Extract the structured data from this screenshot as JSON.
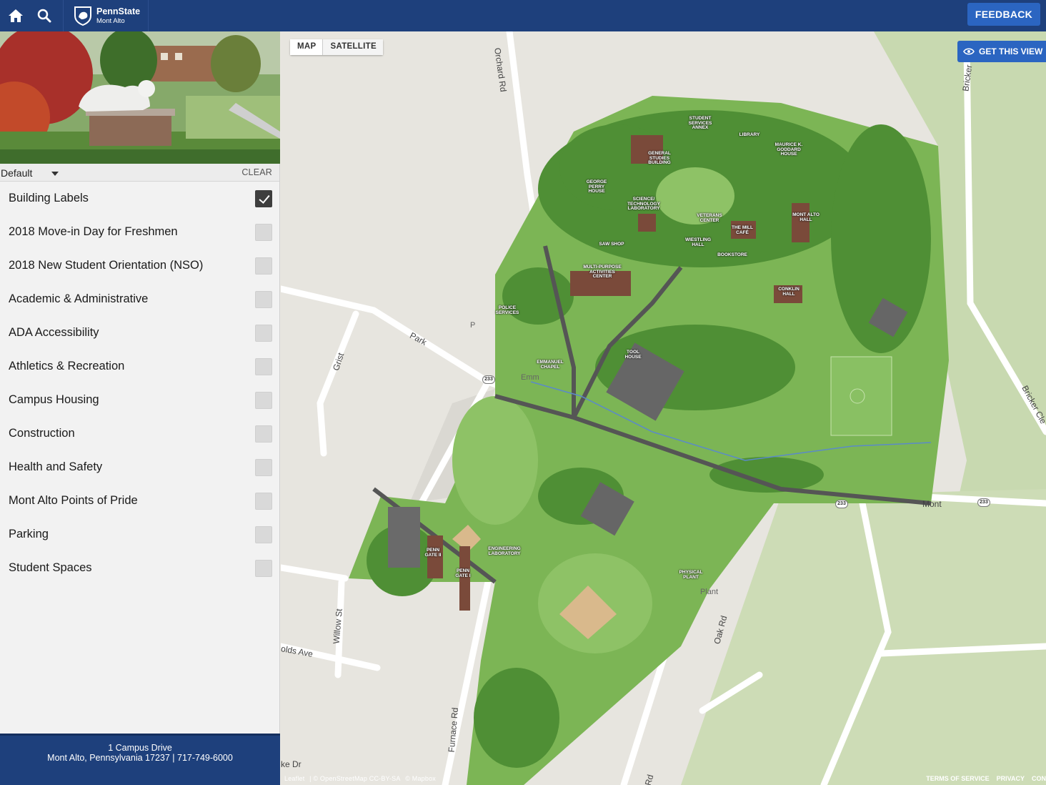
{
  "header": {
    "brand_name": "PennState",
    "brand_campus": "Mont Alto",
    "feedback_label": "FEEDBACK",
    "home_icon": "home-icon",
    "search_icon": "search-icon"
  },
  "sidebar": {
    "layer_selected": "Default",
    "clear_label": "CLEAR",
    "categories": [
      {
        "label": "Building Labels",
        "checked": true
      },
      {
        "label": "2018 Move-in Day for Freshmen",
        "checked": false
      },
      {
        "label": "2018 New Student Orientation (NSO)",
        "checked": false
      },
      {
        "label": "Academic & Administrative",
        "checked": false
      },
      {
        "label": "ADA Accessibility",
        "checked": false
      },
      {
        "label": "Athletics & Recreation",
        "checked": false
      },
      {
        "label": "Campus Housing",
        "checked": false
      },
      {
        "label": "Construction",
        "checked": false
      },
      {
        "label": "Health and Safety",
        "checked": false
      },
      {
        "label": "Mont Alto Points of Pride",
        "checked": false
      },
      {
        "label": "Parking",
        "checked": false
      },
      {
        "label": "Student Spaces",
        "checked": false
      }
    ],
    "footer_line1": "1 Campus Drive",
    "footer_line2": "Mont Alto, Pennsylvania 17237 | 717-749-6000"
  },
  "map": {
    "type_map": "MAP",
    "type_satellite": "SATELLITE",
    "get_view_label": "GET THIS VIEW",
    "attribution": [
      "Leaflet",
      "| © OpenStreetMap CC-BY-SA",
      "© Mapbox"
    ],
    "links": [
      "TERMS OF SERVICE",
      "PRIVACY",
      "CON"
    ],
    "route_number": "233",
    "roads": {
      "orchard": "Orchard Rd",
      "park": "Park",
      "grist": "Grist",
      "willow": "Willow St",
      "reynolds": "olds Ave",
      "furnace": "Furnace Rd",
      "oak": "Oak Rd",
      "bricker": "Bricker Cle",
      "bricker_top": "Bricker Ln",
      "mont": "Mont",
      "pike": "ke Dr",
      "rd": "Rd",
      "plant": "Plant",
      "emm": "Emm",
      "p": "P"
    },
    "buildings": [
      "STUDENT SERVICES ANNEX",
      "LIBRARY",
      "MAURICE K. GODDARD HOUSE",
      "GENERAL STUDIES BUILDING",
      "GEORGE PERRY HOUSE",
      "SCIENCE/ TECHNOLOGY LABORATORY",
      "MONT ALTO HALL",
      "VETERANS CENTER",
      "THE MILL CAFÉ",
      "WIESTLING HALL",
      "SAW SHOP",
      "BOOKSTORE",
      "MULTI-PURPOSE ACTIVITIES CENTER",
      "CONKLIN HALL",
      "POLICE SERVICES",
      "TOOL HOUSE",
      "EMMANUEL CHAPEL",
      "PENN GATE II",
      "ENGINEERING LABORATORY",
      "PENN GATE I",
      "PHYSICAL PLANT"
    ],
    "colors": {
      "header": "#1e407c",
      "accent": "#2b65c1",
      "grass": "#6ba84a",
      "trees": "#4f8f35"
    }
  }
}
